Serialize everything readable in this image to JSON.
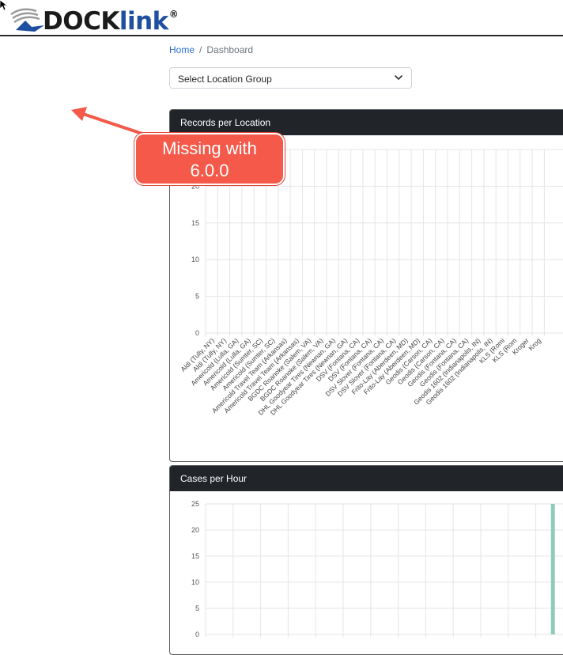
{
  "header": {
    "logo_text": "DOCK",
    "logo_text_accent": "link",
    "logo_reg": "®"
  },
  "breadcrumb": {
    "home": "Home",
    "separator": "/",
    "current": "Dashboard"
  },
  "location_select": {
    "selected": "Select Location Group"
  },
  "annotation": {
    "line1": "Missing with",
    "line2": "6.0.0",
    "color": "#f4594a"
  },
  "charts": {
    "records_title": "Records per Location",
    "cases_title": "Cases per Hour"
  },
  "chart_data": [
    {
      "type": "bar",
      "title": "Records per Location",
      "ylim": [
        0,
        25
      ],
      "yticks": [
        0,
        5,
        10,
        15,
        20
      ],
      "grid": true,
      "categories": [
        "Aldi (Tully, NY)",
        "Aldi (Tully, NY)",
        "Americold (Lulla, GA)",
        "Americold (Lulla, GA)",
        "Americold (Sumter, SC)",
        "Americold (Sumter, SC)",
        "Americold Travel Team (Arkansas)",
        "Americold Travel Team (Arkansas)",
        "BGDC Roanoke (Salem, VA)",
        "BGDC Roanoke (Salem, VA)",
        "DHL Goodyear Tires (Newnan, GA)",
        "DHL Goodyear Tires (Newnan, GA)",
        "DSV (Fontana, CA)",
        "DSV (Fontana, CA)",
        "DSV Slover (Fontana, CA)",
        "DSV Slover (Fontana, CA)",
        "Frito-Lay (Aberdeen, MD)",
        "Frito-Lay (Aberdeen, MD)",
        "Geodis (Carson, CA)",
        "Geodis (Carson, CA)",
        "Geodis (Fontana, CA)",
        "Geodis (Fontana, CA)",
        "Geodis 1602 (Indianapolis, IN)",
        "Geodis 1602 (Indianapolis, IN)",
        "KLS (Romi",
        "KLS (Rom",
        "Kroger",
        "Krog"
      ],
      "values": [
        0,
        0,
        0,
        0,
        0,
        0,
        0,
        0,
        0,
        0,
        0,
        0,
        0,
        0,
        0,
        0,
        0,
        0,
        0,
        0,
        0,
        0,
        0,
        0,
        0,
        0,
        0,
        0
      ]
    },
    {
      "type": "bar",
      "title": "Cases per Hour",
      "ylim": [
        0,
        25
      ],
      "yticks": [
        0,
        5,
        10,
        15,
        20,
        25
      ],
      "grid": true,
      "bar_color": "#8fcbbb",
      "bar_slot": 12,
      "slots": 14,
      "bar_value": 25
    }
  ]
}
